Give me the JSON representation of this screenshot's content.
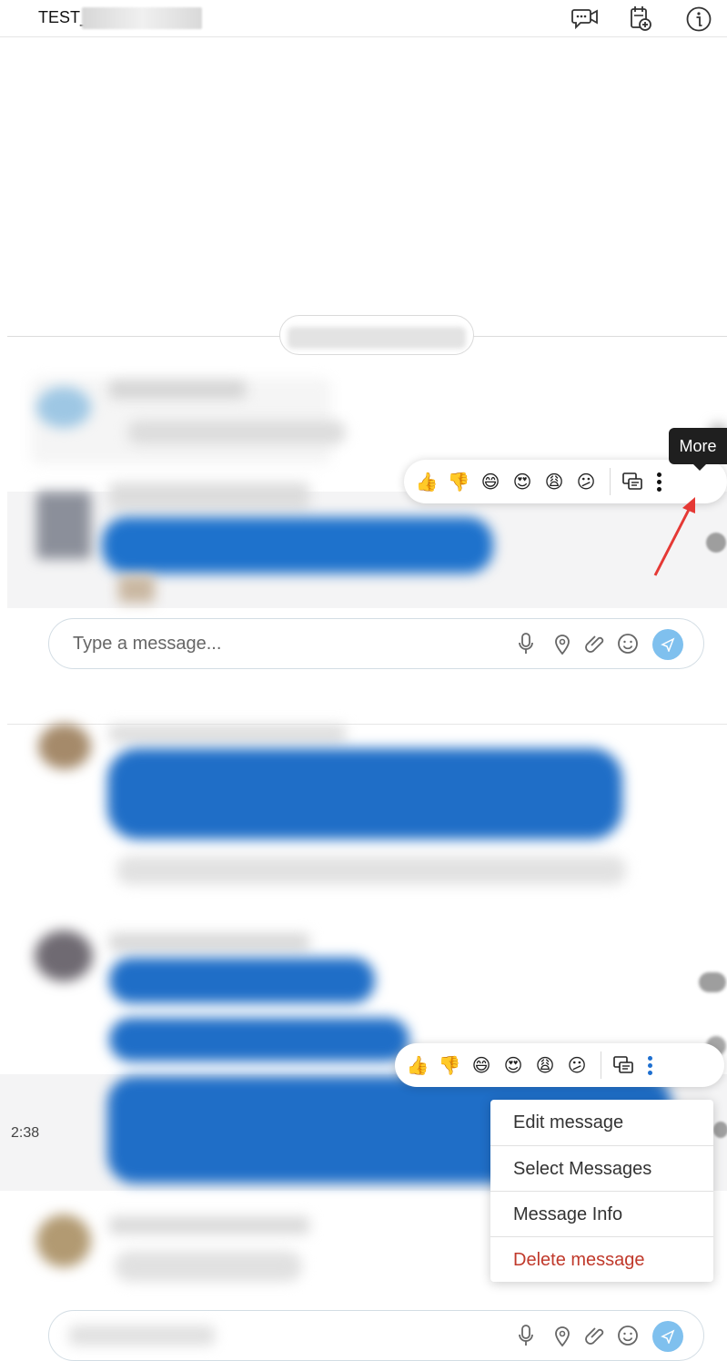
{
  "header": {
    "title": "TEST_",
    "icons": [
      "video-chat-icon",
      "calendar-add-icon",
      "info-icon"
    ]
  },
  "tooltip": {
    "text": "More"
  },
  "reactions": {
    "emojis": [
      "👍",
      "👎",
      "😄",
      "😍",
      "😩",
      "😕"
    ],
    "reply_icon": "reply-thread-icon",
    "more_icon": "more-vertical-icon"
  },
  "composer": {
    "placeholder": "Type a message...",
    "icons": [
      "microphone-icon",
      "location-icon",
      "attachment-icon",
      "emoji-icon",
      "send-icon"
    ]
  },
  "message_menu": {
    "items": [
      {
        "label": "Edit message"
      },
      {
        "label": "Select Messages"
      },
      {
        "label": "Message Info"
      },
      {
        "label": "Delete message"
      }
    ],
    "danger_color": "#c0392b"
  },
  "time_partial": "2:38",
  "colors": {
    "accent": "#1e6fd0",
    "send": "#7fc0ee",
    "arrow": "#e53935"
  }
}
